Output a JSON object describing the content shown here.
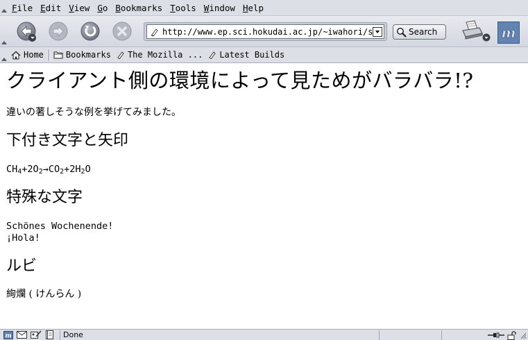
{
  "menu": {
    "items": [
      {
        "label": "File",
        "accel": "F",
        "rest": "ile"
      },
      {
        "label": "Edit",
        "accel": "E",
        "rest": "dit"
      },
      {
        "label": "View",
        "accel": "V",
        "rest": "iew"
      },
      {
        "label": "Go",
        "accel": "G",
        "rest": "o"
      },
      {
        "label": "Bookmarks",
        "accel": "B",
        "rest": "ookmarks"
      },
      {
        "label": "Tools",
        "accel": "T",
        "rest": "ools"
      },
      {
        "label": "Window",
        "accel": "W",
        "rest": "indow"
      },
      {
        "label": "Help",
        "accel": "H",
        "rest": "elp"
      }
    ]
  },
  "navbar": {
    "url": "http://www.ep.sci.hokudai.ac.jp/~iwahori/sample",
    "search_label": "Search"
  },
  "personal_toolbar": {
    "home": "Home",
    "bookmarks": "Bookmarks",
    "mozilla": "The Mozilla ...",
    "latest": "Latest Builds"
  },
  "content": {
    "title": "クライアント側の環境によって見ためがバラバラ!?",
    "intro": "違いの著しそうな例を挙げてみました。",
    "section1_heading": "下付き文字と矢印",
    "formula": {
      "a": "CH",
      "a_sub": "4",
      "b": "+2O",
      "b_sub": "2",
      "arrow": "→",
      "c": "CO",
      "c_sub": "2",
      "d": "+2H",
      "d_sub": "2",
      "e": "O"
    },
    "section2_heading": "特殊な文字",
    "special_line1": "Schönes Wochenende!",
    "special_line2": "¡Hola!",
    "section3_heading": "ルビ",
    "ruby_text": "絢爛 ( けんらん )"
  },
  "status": {
    "text": "Done"
  },
  "colors": {
    "chrome": "#dcdfe6",
    "throbber": "#5f80ae"
  }
}
